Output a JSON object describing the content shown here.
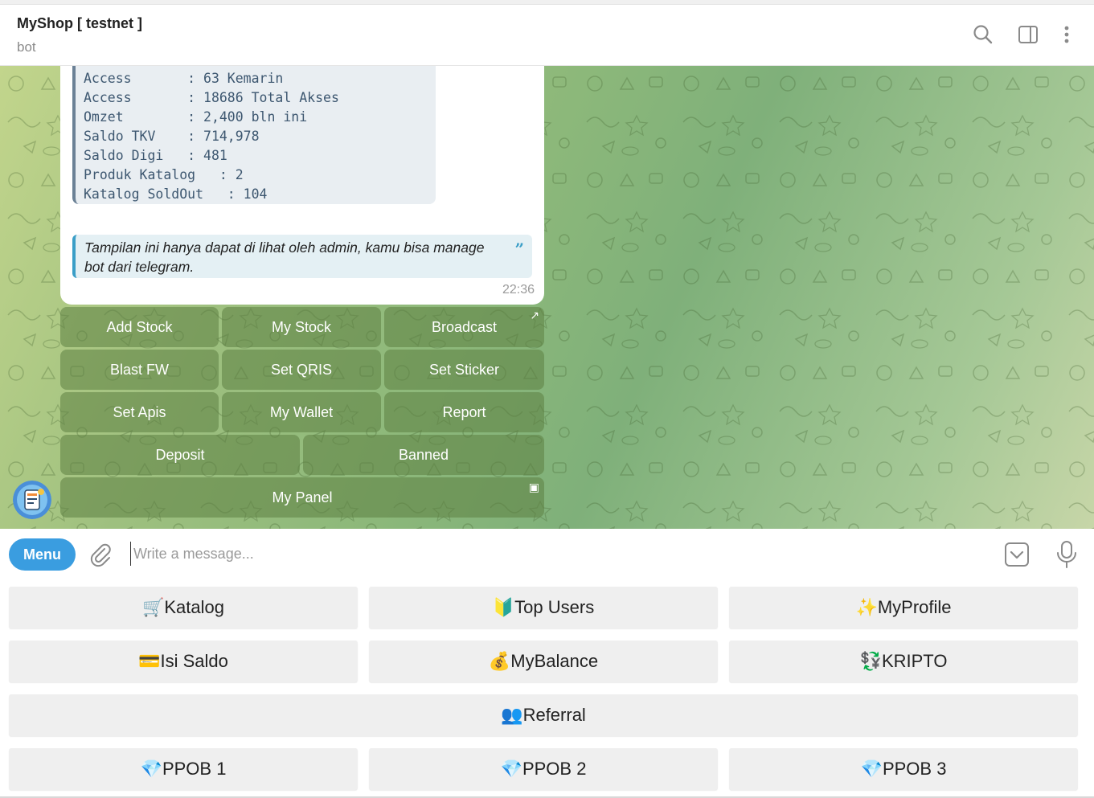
{
  "header": {
    "title": "MyShop [ testnet ]",
    "subtitle": "bot"
  },
  "message": {
    "stats": [
      "Access       : 63 Kemarin",
      "Access       : 18686 Total Akses",
      "Omzet        : 2,400 bln ini",
      "Saldo TKV    : 714,978",
      "Saldo Digi   : 481",
      "Produk Katalog   : 2",
      "Katalog SoldOut   : 104"
    ],
    "quote": "Tampilan ini hanya dapat di lihat oleh admin, kamu bisa manage bot dari telegram.",
    "quote_icon": "”",
    "time": "22:36"
  },
  "inline_keyboard": {
    "add_stock": "Add Stock",
    "my_stock": "My Stock",
    "broadcast": "Broadcast",
    "broadcast_corner": "↗",
    "blast_fw": "Blast FW",
    "set_qris": "Set QRIS",
    "set_sticker": "Set Sticker",
    "set_apis": "Set Apis",
    "my_wallet": "My Wallet",
    "report": "Report",
    "deposit": "Deposit",
    "banned": "Banned",
    "my_panel": "My Panel",
    "my_panel_corner": "▣"
  },
  "composer": {
    "menu_label": "Menu",
    "placeholder": "Write a message..."
  },
  "reply_keyboard": {
    "katalog": "🛒Katalog",
    "top_users": "🔰Top Users",
    "myprofile": "✨MyProfile",
    "isi_saldo": "💳Isi Saldo",
    "mybalance": "💰MyBalance",
    "kripto": "💱KRIPTO",
    "referral": "👥Referral",
    "ppob1": "💎PPOB 1",
    "ppob2": "💎PPOB 2",
    "ppob3": "💎PPOB 3"
  },
  "icons": {
    "search": "search-icon",
    "sidebar": "sidebar-toggle-icon",
    "more": "more-vertical-icon",
    "attach": "paperclip-icon",
    "keyboard": "keyboard-toggle-icon",
    "mic": "microphone-icon"
  },
  "colors": {
    "accent": "#3a9de0",
    "quote_bar": "#3a9ec7",
    "inline_button": "#5c8042"
  }
}
